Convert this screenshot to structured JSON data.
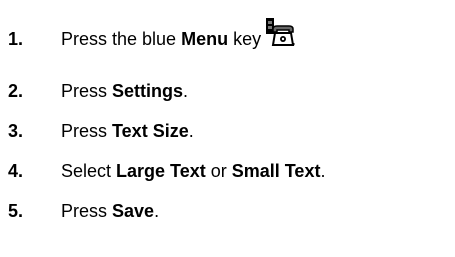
{
  "steps": [
    {
      "number": "1.",
      "parts": [
        "Press the blue ",
        "Menu",
        " key",
        "."
      ],
      "icon": "desk-phone-icon"
    },
    {
      "number": "2.",
      "parts": [
        "Press ",
        "Settings",
        "."
      ]
    },
    {
      "number": "3.",
      "parts": [
        "Press ",
        "Text Size",
        "."
      ]
    },
    {
      "number": "4.",
      "parts": [
        "Select ",
        "Large Text",
        " or ",
        "Small Text",
        "."
      ]
    },
    {
      "number": "5.",
      "parts": [
        "Press ",
        "Save",
        "."
      ]
    }
  ]
}
